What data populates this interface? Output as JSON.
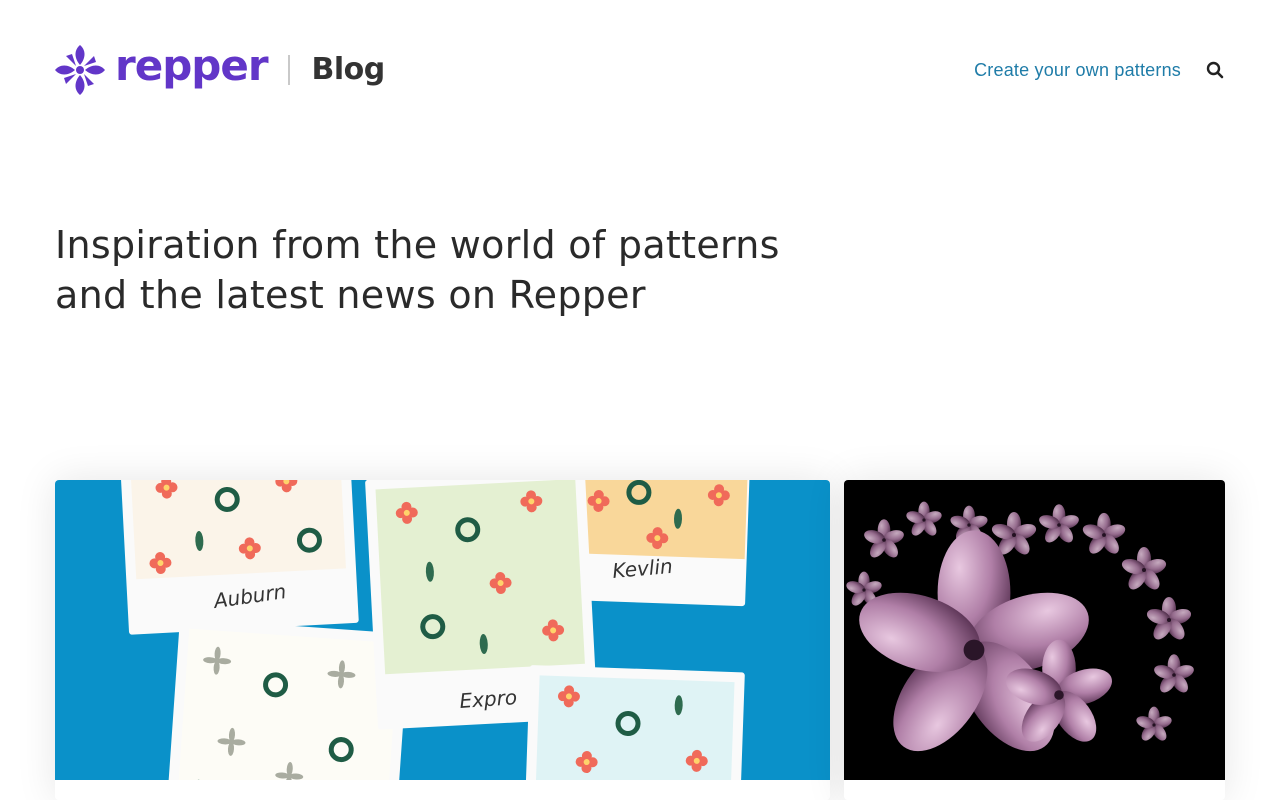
{
  "header": {
    "logo_text": "repper",
    "section_label": "Blog",
    "nav_link_label": "Create your own patterns"
  },
  "hero": {
    "title_line1": "Inspiration from the world of patterns",
    "title_line2": "and the latest news on Repper"
  },
  "cards": [
    {
      "swatch_labels": [
        "Auburn",
        "Kevlin",
        "Expro"
      ]
    },
    {}
  ],
  "colors": {
    "brand_purple": "#6236c8",
    "link_blue": "#1f7ca8",
    "card1_background": "#0a91c9",
    "card2_background": "#000000"
  },
  "icons": {
    "logo": "repper-flower-logo-icon",
    "search": "search-icon"
  }
}
